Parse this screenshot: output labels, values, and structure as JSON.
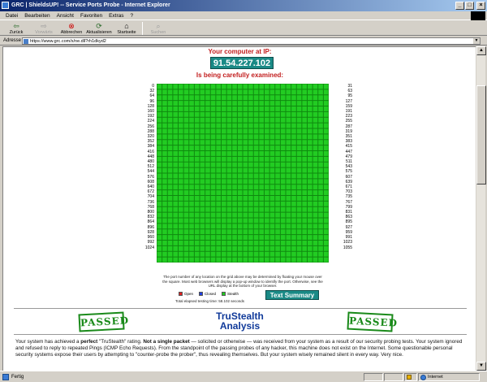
{
  "window": {
    "title": "GRC | ShieldsUP! -- Service Ports Probe - Internet Explorer",
    "controls": [
      "_",
      "□",
      "×"
    ]
  },
  "menu": [
    "Datei",
    "Bearbeiten",
    "Ansicht",
    "Favoriten",
    "Extras",
    "?"
  ],
  "toolbar": {
    "back": "Zurück",
    "forward": "Vorwärts",
    "stop": "Abbrechen",
    "refresh": "Aktualisieren",
    "home": "Startseite",
    "search": "Suchen"
  },
  "address": {
    "label": "Adresse",
    "url": "https://www.grc.com/x/ne.dll?rh1dkyd2"
  },
  "probe": {
    "heading": "Your computer at IP:",
    "ip": "91.54.227.102",
    "examined": "Is being carefully examined:",
    "grid_cols": 32,
    "grid_rows": 32,
    "port_labels_left": [
      "0",
      "32",
      "64",
      "96",
      "128",
      "160",
      "192",
      "224",
      "256",
      "288",
      "320",
      "352",
      "384",
      "416",
      "448",
      "480",
      "512",
      "544",
      "576",
      "608",
      "640",
      "672",
      "704",
      "736",
      "768",
      "800",
      "832",
      "864",
      "896",
      "928",
      "960",
      "992",
      "1024"
    ],
    "port_labels_right": [
      "31",
      "63",
      "95",
      "127",
      "159",
      "191",
      "223",
      "255",
      "287",
      "319",
      "351",
      "383",
      "415",
      "447",
      "479",
      "511",
      "543",
      "575",
      "607",
      "639",
      "671",
      "703",
      "735",
      "767",
      "799",
      "831",
      "863",
      "895",
      "927",
      "959",
      "991",
      "1023",
      "1055"
    ],
    "description": "The port number of any location on the grid above may be determined by floating your mouse over the square. Most web browsers will display a pop-up window to identify the port. Otherwise, see the URL display at the bottom of your browser.",
    "legend": [
      {
        "label": "Open",
        "color": "#e02020"
      },
      {
        "label": "Closed",
        "color": "#2040e0"
      },
      {
        "label": "Stealth",
        "color": "#22cc22"
      }
    ],
    "elapsed": "Total elapsed testing time: 58.102 seconds",
    "summary_button": "Text Summary"
  },
  "analysis": {
    "stamp_left": "PASSED",
    "stamp_right": "PASSED",
    "title_line1": "TruStealth",
    "title_line2": "Analysis",
    "p1": "Your system has achieved a ",
    "p_bold1": "perfect",
    "p2": " \"TruStealth\" rating. ",
    "p_bold2": "Not a single packet",
    "p3": " — solicited or otherwise — was received from your system as a result of our security probing tests. Your system ignored and refused to reply to repeated Pings (ICMP Echo Requests). From the standpoint of the passing probes of any hacker, this machine does not exist on the Internet. Some questionable personal security systems expose their users by attempting to \"counter-probe the prober\", thus revealing themselves. But your system wisely remained silent in every way. Very nice."
  },
  "status": {
    "left": "Fertig",
    "zone": "Internet"
  }
}
